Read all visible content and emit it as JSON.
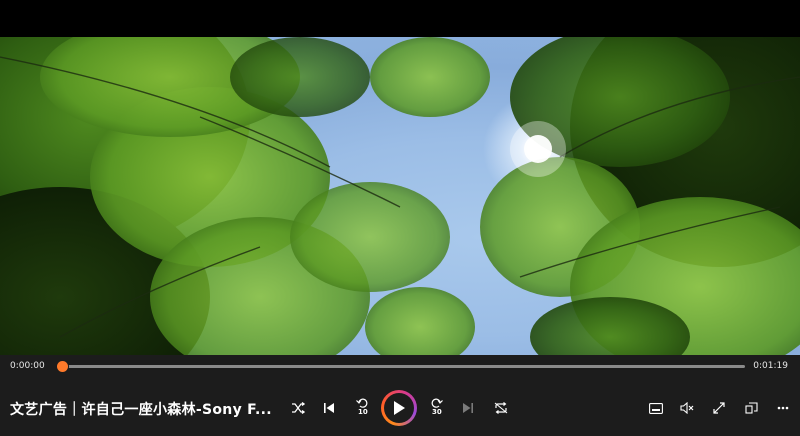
{
  "video": {
    "title": "文艺广告｜许自己一座小森林-Sony F..."
  },
  "playback": {
    "current_time": "0:00:00",
    "duration": "0:01:19",
    "progress": 0.003
  },
  "controls": {
    "left_icons": [
      "shuffle-icon",
      "previous-icon",
      "skip-back-10-icon",
      "play-icon",
      "skip-forward-30-icon",
      "next-icon",
      "repeat-off-icon"
    ],
    "skip_back_label": "10",
    "skip_forward_label": "30",
    "right_icons": [
      "miniplayer-icon",
      "volume-mute-icon",
      "fullscreen-icon",
      "cast-icon",
      "more-icon"
    ],
    "accent_color": "#ff6a1a"
  }
}
